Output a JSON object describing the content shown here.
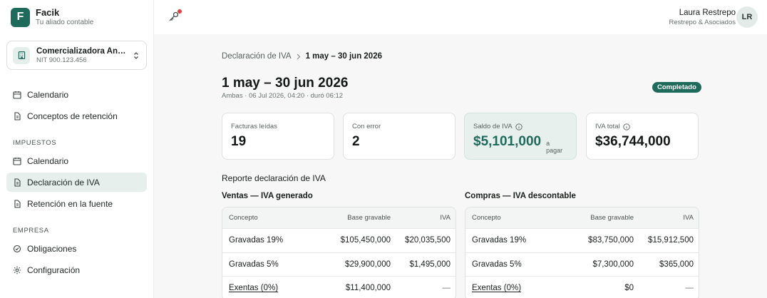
{
  "brand": {
    "logo_letter": "F",
    "name": "Facik",
    "tagline": "Tu aliado contable"
  },
  "company": {
    "name": "Comercializadora Andina S.A.S.",
    "nit": "NIT 900.123.456"
  },
  "sidebar": {
    "top_items": [
      {
        "label": "Calendario",
        "icon": "calendar-icon"
      },
      {
        "label": "Conceptos de retención",
        "icon": "document-icon"
      }
    ],
    "section_impuestos": "IMPUESTOS",
    "impuestos_items": [
      {
        "label": "Calendario",
        "icon": "calendar-icon"
      },
      {
        "label": "Declaración de IVA",
        "icon": "document-icon",
        "active": true
      },
      {
        "label": "Retención en la fuente",
        "icon": "document-icon"
      }
    ],
    "section_empresa": "EMPRESA",
    "empresa_items": [
      {
        "label": "Obligaciones",
        "icon": "badge-icon"
      },
      {
        "label": "Configuración",
        "icon": "gear-icon"
      }
    ]
  },
  "header": {
    "notification_icon": "key-icon",
    "user_name": "Laura Restrepo",
    "user_org": "Restrepo & Asociados",
    "avatar_initials": "LR"
  },
  "breadcrumb": {
    "parent": "Declaración de IVA",
    "current": "1 may – 30 jun 2026"
  },
  "page": {
    "title": "1 may – 30 jun 2026",
    "meta": "Ambas · 06 Jul 2026, 04:20 · duró 06:12",
    "status": "Completado"
  },
  "cards": [
    {
      "label": "Facturas leídas",
      "value": "19"
    },
    {
      "label": "Con error",
      "value": "2"
    },
    {
      "label": "Saldo de IVA",
      "value": "$5,101,000",
      "suffix": "a pagar",
      "info": true
    },
    {
      "label": "IVA total",
      "value": "$36,744,000",
      "info": true
    }
  ],
  "report": {
    "title": "Reporte declaración de IVA",
    "ventas": {
      "title": "Ventas — IVA generado",
      "headers": [
        "Concepto",
        "Base gravable",
        "IVA"
      ],
      "rows": [
        [
          "Gravadas 19%",
          "$105,450,000",
          "$20,035,500"
        ],
        [
          "Gravadas 5%",
          "$29,900,000",
          "$1,495,000"
        ],
        [
          "Exentas (0%)",
          "$11,400,000",
          "—"
        ]
      ]
    },
    "compras": {
      "title": "Compras — IVA descontable",
      "headers": [
        "Concepto",
        "Base gravable",
        "IVA"
      ],
      "rows": [
        [
          "Gravadas 19%",
          "$83,750,000",
          "$15,912,500"
        ],
        [
          "Gravadas 5%",
          "$7,300,000",
          "$365,000"
        ],
        [
          "Exentas (0%)",
          "$0",
          "—"
        ]
      ]
    }
  },
  "colors": {
    "accent": "#1e6a5b",
    "accent_light": "#e7f0ed",
    "danger": "#e04040"
  }
}
